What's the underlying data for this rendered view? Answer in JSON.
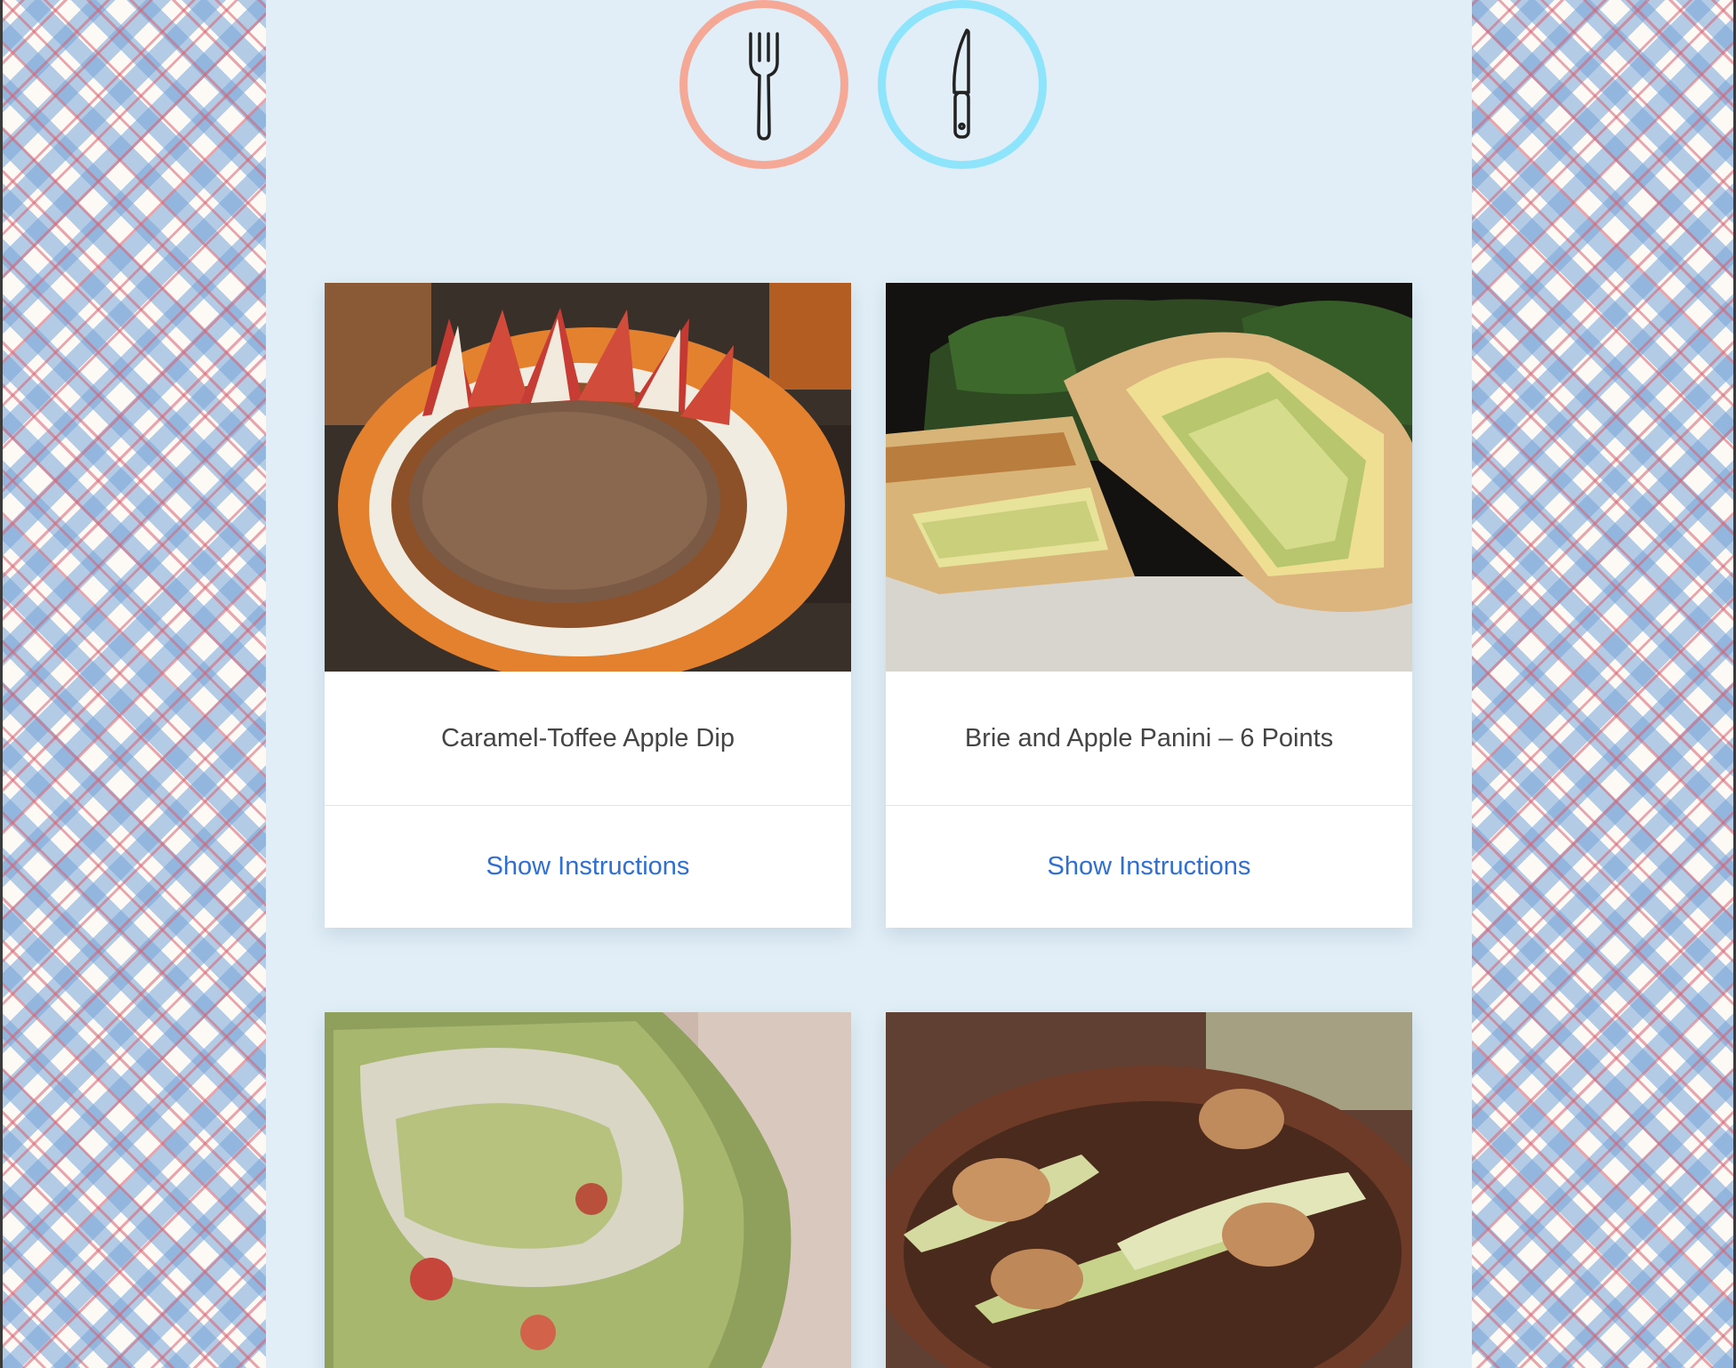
{
  "header": {
    "icons": [
      {
        "name": "fork-icon",
        "ring_color": "#f6a896"
      },
      {
        "name": "knife-icon",
        "ring_color": "#8ee4fb"
      }
    ]
  },
  "recipes": [
    {
      "title": "Caramel-Toffee Apple Dip",
      "action": "Show Instructions",
      "image": "caramel-toffee-apple-dip-photo"
    },
    {
      "title": "Brie and Apple Panini – 6 Points",
      "action": "Show Instructions",
      "image": "brie-apple-panini-photo"
    },
    {
      "title": "",
      "action": "",
      "image": "brussels-sprout-apple-slaw-photo"
    },
    {
      "title": "",
      "action": "",
      "image": "apple-slices-peanut-butter-photo"
    }
  ],
  "colors": {
    "panel_bg": "#e1eef7",
    "link": "#2f6fd4",
    "title_text": "#444444",
    "fork_ring": "#f6a896",
    "knife_ring": "#8ee4fb"
  }
}
